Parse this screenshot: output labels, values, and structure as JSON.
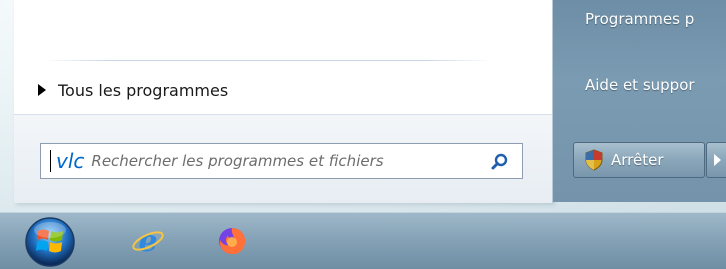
{
  "start_menu": {
    "all_programs_label": "Tous les programmes",
    "search": {
      "value": "vlc",
      "placeholder": "Rechercher les programmes et fichiers"
    },
    "right_pane": {
      "items": [
        {
          "label": "Programmes p"
        },
        {
          "label": "Aide et suppor"
        }
      ],
      "shutdown_label": "Arrêter"
    }
  },
  "taskbar": {
    "icons": [
      "windows-start-orb-icon",
      "internet-explorer-icon",
      "firefox-icon"
    ]
  },
  "colors": {
    "right_pane": "#7594ac",
    "search_text": "#0066cc",
    "taskbar": "#86a3b7"
  }
}
